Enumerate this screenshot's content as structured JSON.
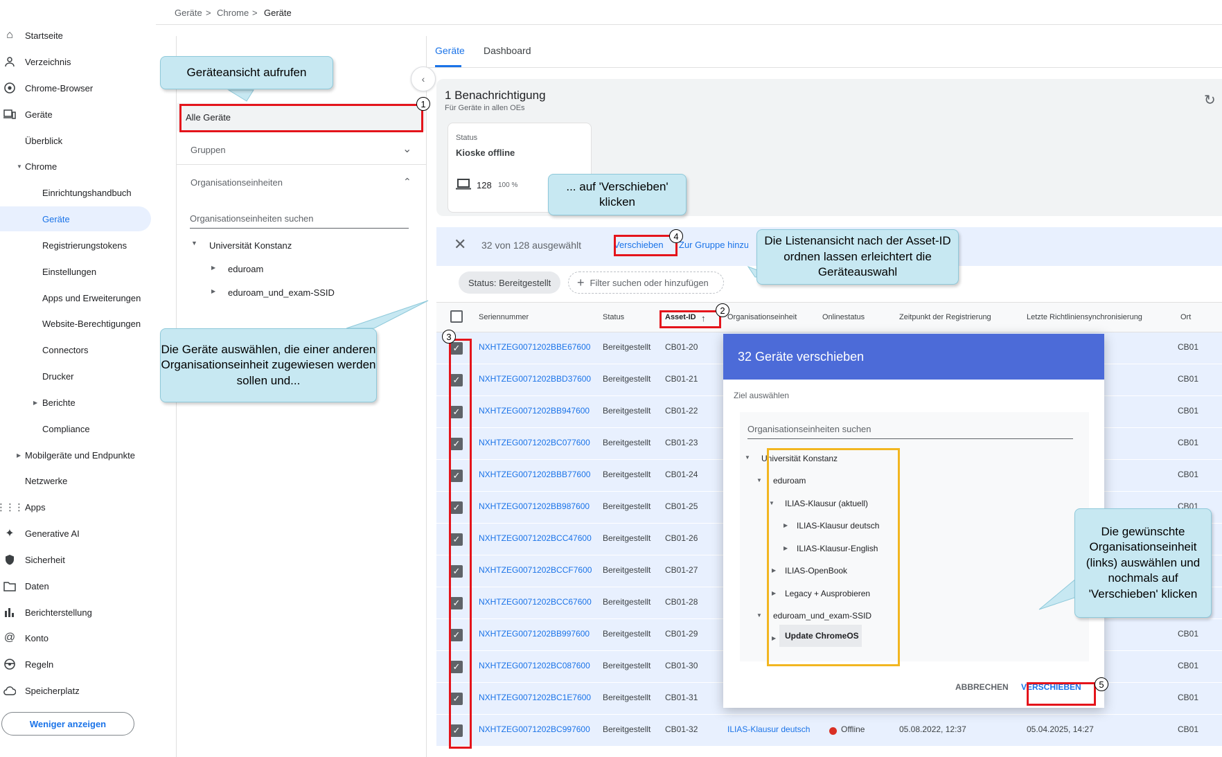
{
  "breadcrumb": [
    "Geräte",
    "Chrome",
    "Geräte"
  ],
  "nav": {
    "items": [
      {
        "label": "Startseite",
        "icon": "home-icon"
      },
      {
        "label": "Verzeichnis",
        "icon": "person-icon"
      },
      {
        "label": "Chrome-Browser",
        "icon": "chrome-icon"
      },
      {
        "label": "Geräte",
        "icon": "devices-icon"
      },
      {
        "label": "Überblick"
      },
      {
        "label": "Chrome"
      },
      {
        "label": "Einrichtungshandbuch"
      },
      {
        "label": "Geräte"
      },
      {
        "label": "Registrierungstokens"
      },
      {
        "label": "Einstellungen"
      },
      {
        "label": "Apps und Erweiterungen"
      },
      {
        "label": "Website-Berechtigungen"
      },
      {
        "label": "Connectors"
      },
      {
        "label": "Drucker"
      },
      {
        "label": "Berichte"
      },
      {
        "label": "Compliance"
      },
      {
        "label": "Mobilgeräte und Endpunkte"
      },
      {
        "label": "Netzwerke"
      },
      {
        "label": "Apps",
        "icon": "apps-grid-icon"
      },
      {
        "label": "Generative AI",
        "icon": "sparkle-icon"
      },
      {
        "label": "Sicherheit",
        "icon": "shield-icon"
      },
      {
        "label": "Daten",
        "icon": "folder-icon"
      },
      {
        "label": "Berichterstellung",
        "icon": "bar-chart-icon"
      },
      {
        "label": "Konto",
        "icon": "at-icon"
      },
      {
        "label": "Regeln",
        "icon": "steering-icon"
      },
      {
        "label": "Speicherplatz",
        "icon": "cloud-icon"
      }
    ],
    "less_button": "Weniger anzeigen"
  },
  "middle": {
    "all_devices": "Alle Geräte",
    "groups": "Gruppen",
    "org_units": "Organisationseinheiten",
    "search_placeholder": "Organisationseinheiten suchen",
    "tree": [
      "Universität Konstanz",
      "eduroam",
      "eduroam_und_exam-SSID"
    ]
  },
  "tabs": [
    "Geräte",
    "Dashboard"
  ],
  "notification": {
    "title": "1 Benachrichtigung",
    "subtitle": "Für Geräte in allen OEs",
    "status_label": "Status",
    "status_value": "Kioske offline",
    "count": "128",
    "percent": "100 %"
  },
  "action_bar": {
    "selected": "32 von 128 ausgewählt",
    "move": "Verschieben",
    "add_group": "Zur Gruppe hinzu"
  },
  "filters": {
    "chip": "Status: Bereitgestellt",
    "add": "Filter suchen oder hinzufügen"
  },
  "table": {
    "headers": [
      "Seriennummer",
      "Status",
      "Asset-ID",
      "Organisationseinheit",
      "Onlinestatus",
      "Zeitpunkt der Registrierung",
      "Letzte Richtliniensynchronisierung",
      "Ort"
    ],
    "sort_arrow": "↑",
    "rows": [
      {
        "serial": "NXHTZEG0071202BBE67600",
        "status": "Bereitgestellt",
        "asset": "CB01-20",
        "ort": "CB01"
      },
      {
        "serial": "NXHTZEG0071202BBD37600",
        "status": "Bereitgestellt",
        "asset": "CB01-21",
        "ort": "CB01"
      },
      {
        "serial": "NXHTZEG0071202BB947600",
        "status": "Bereitgestellt",
        "asset": "CB01-22",
        "ort": "CB01"
      },
      {
        "serial": "NXHTZEG0071202BC077600",
        "status": "Bereitgestellt",
        "asset": "CB01-23",
        "ort": "CB01"
      },
      {
        "serial": "NXHTZEG0071202BBB77600",
        "status": "Bereitgestellt",
        "asset": "CB01-24",
        "ort": "CB01"
      },
      {
        "serial": "NXHTZEG0071202BB987600",
        "status": "Bereitgestellt",
        "asset": "CB01-25",
        "ort": "CB01"
      },
      {
        "serial": "NXHTZEG0071202BCC47600",
        "status": "Bereitgestellt",
        "asset": "CB01-26",
        "ort": ""
      },
      {
        "serial": "NXHTZEG0071202BCCF7600",
        "status": "Bereitgestellt",
        "asset": "CB01-27",
        "ort": ""
      },
      {
        "serial": "NXHTZEG0071202BCC67600",
        "status": "Bereitgestellt",
        "asset": "CB01-28",
        "ort": ""
      },
      {
        "serial": "NXHTZEG0071202BB997600",
        "status": "Bereitgestellt",
        "asset": "CB01-29",
        "ort": "CB01"
      },
      {
        "serial": "NXHTZEG0071202BC087600",
        "status": "Bereitgestellt",
        "asset": "CB01-30",
        "ort": "CB01"
      },
      {
        "serial": "NXHTZEG0071202BC1E7600",
        "status": "Bereitgestellt",
        "asset": "CB01-31",
        "ort": "CB01"
      },
      {
        "serial": "NXHTZEG0071202BC997600",
        "status": "Bereitgestellt",
        "asset": "CB01-32",
        "ort": "CB01",
        "ou": "ILIAS-Klausur deutsch",
        "online": "Offline",
        "registered": "05.08.2022, 12:37",
        "sync": "05.04.2025, 14:27"
      }
    ]
  },
  "dialog": {
    "title": "32 Geräte verschieben",
    "target_label": "Ziel auswählen",
    "search_placeholder": "Organisationseinheiten suchen",
    "tree": [
      "Universität Konstanz",
      "eduroam",
      "ILIAS-Klausur (aktuell)",
      "ILIAS-Klausur deutsch",
      "ILIAS-Klausur-English",
      "ILIAS-OpenBook",
      "Legacy + Ausprobieren",
      "eduroam_und_exam-SSID",
      "Update ChromeOS"
    ],
    "cancel": "ABBRECHEN",
    "confirm": "VERSCHIEBEN"
  },
  "callouts": {
    "c1": "Geräteansicht aufrufen",
    "c2": "... auf 'Verschieben' klicken",
    "c3": "Die Listenansicht nach der Asset-ID ordnen lassen erleichtert die Geräteauswahl",
    "c4": "Die Geräte auswählen, die einer anderen Organisationseinheit zugewiesen werden sollen und...",
    "c5": "Die gewünschte Organisationseinheit (links) auswählen und nochmals auf 'Verschieben' klicken"
  },
  "markers": [
    "1",
    "2",
    "3",
    "4",
    "5"
  ],
  "colors": {
    "accent": "#1a73e8",
    "dialog_header": "#4c6bd8",
    "selection": "#e8f0fe",
    "annotation_red": "#e4141b",
    "annotation_yellow": "#f2b620",
    "callout": "#c7e8f2",
    "offline": "#d93025"
  }
}
